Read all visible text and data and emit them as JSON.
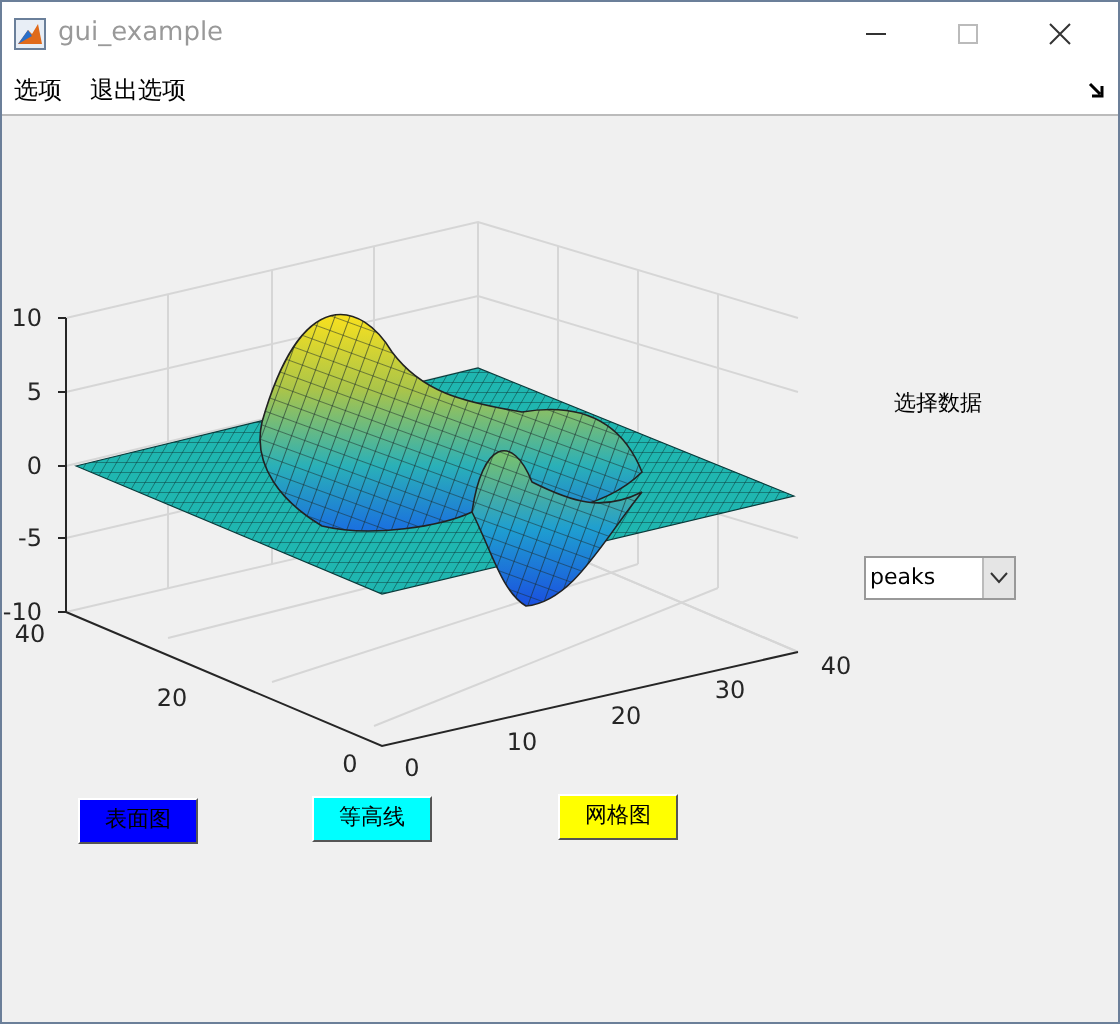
{
  "window": {
    "title": "gui_example"
  },
  "menu": [
    "选项",
    "退出选项"
  ],
  "plot": {
    "zticks": [
      "10",
      "5",
      "0",
      "-5",
      "-10"
    ],
    "yticks": [
      "40",
      "20",
      "0"
    ],
    "xticks": [
      "0",
      "10",
      "20",
      "30",
      "40"
    ]
  },
  "data_label": "选择数据",
  "dropdown": {
    "value": "peaks"
  },
  "buttons": [
    {
      "label": "表面图",
      "color": "#0000ff"
    },
    {
      "label": "等高线",
      "color": "#00ffff"
    },
    {
      "label": "网格图",
      "color": "#ffff00"
    }
  ]
}
